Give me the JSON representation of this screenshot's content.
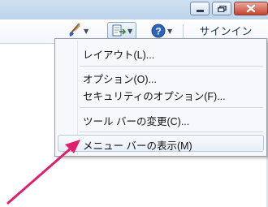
{
  "window": {
    "controls": [
      "minimize",
      "restore",
      "close"
    ]
  },
  "toolbar": {
    "items": [
      {
        "icon": "paint-brush-icon",
        "has_dropdown": true
      },
      {
        "icon": "page-icon",
        "has_dropdown": true,
        "pressed": true
      },
      {
        "icon": "help-icon",
        "has_dropdown": true
      }
    ],
    "signin_label": "サインイン"
  },
  "menu": {
    "items": [
      {
        "label": "レイアウト(L)..."
      },
      {
        "label": "オプション(O)..."
      },
      {
        "label": "セキュリティのオプション(F)..."
      },
      {
        "label": "ツール バーの変更(C)..."
      },
      {
        "label": "メニュー バーの表示(M)",
        "highlighted": true
      }
    ]
  },
  "colors": {
    "annotation_arrow": "#e0206e",
    "help_icon": "#2d63b8",
    "close_button": "#c7432f"
  }
}
